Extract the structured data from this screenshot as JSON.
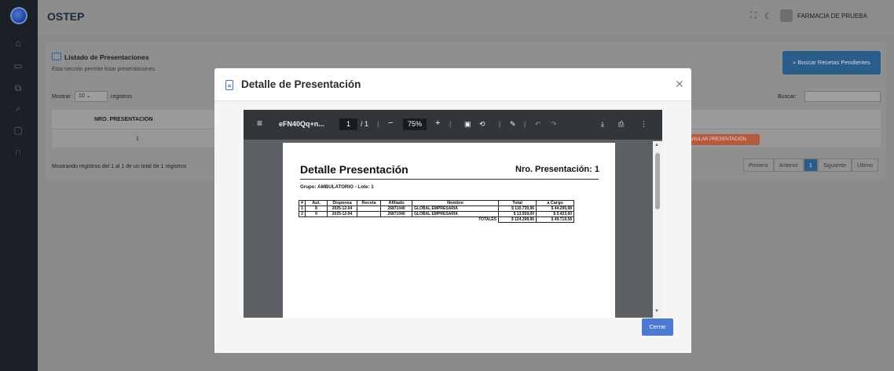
{
  "app": {
    "title": "OSTEP",
    "user": "FARMACIA DE PRUEBA"
  },
  "icons": {
    "sidebar": [
      "home-icon",
      "monitor-icon",
      "clipboard-icon",
      "search-icon",
      "folder-icon",
      "headset-icon"
    ],
    "topbar": [
      "fullscreen-icon",
      "moon-icon"
    ]
  },
  "page": {
    "card_title": "Listado de Presentaciones",
    "card_subtitle": "Esta sección permite listar presentaciones.",
    "search_button": "Buscar Recetas Pendientes",
    "show_label": "Mostrar",
    "show_value": "10",
    "records_label": "registros",
    "search_label": "Buscar:",
    "table_header": "NRO. PRESENTACION",
    "table_row_value": "1",
    "anular_button": "ANULAR PRESENTACIÓN",
    "info": "Mostrando registros del 1 al 1 de un total de 1 registros",
    "pagination": [
      "Primero",
      "Anterior",
      "1",
      "Siguiente",
      "Último"
    ]
  },
  "modal": {
    "title": "Detalle de Presentación",
    "close_button": "Cerrar",
    "pdf": {
      "file_name": "eFN40Qq+n...",
      "page_current": "1",
      "page_total": "/ 1",
      "zoom": "75%",
      "document": {
        "title": "Detalle Presentación",
        "number_label": "Nro. Presentación: 1",
        "group": "Grupo:  AMBULATORIO  -  Lote:  1",
        "columns": [
          "#",
          "Aut.",
          "Dispensa",
          "Receta",
          "Afiliado",
          "Nombre",
          "Total",
          "a Cargo"
        ],
        "rows": [
          [
            "1",
            "8",
            "2025-12-04",
            "",
            "26871040",
            "GLOBAL EMPRESARIA",
            "$ 110.739,96",
            "$ 44.295,98"
          ],
          [
            "2",
            "9",
            "2025-12-04",
            "",
            "26871040",
            "GLOBAL EMPRESARIA",
            "$ 13.559,00",
            "$ 5.423,60"
          ]
        ],
        "totals_label": "TOTALES",
        "totals_total": "$ 124.298,96",
        "totals_cargo": "$ 49.719,58"
      }
    }
  }
}
